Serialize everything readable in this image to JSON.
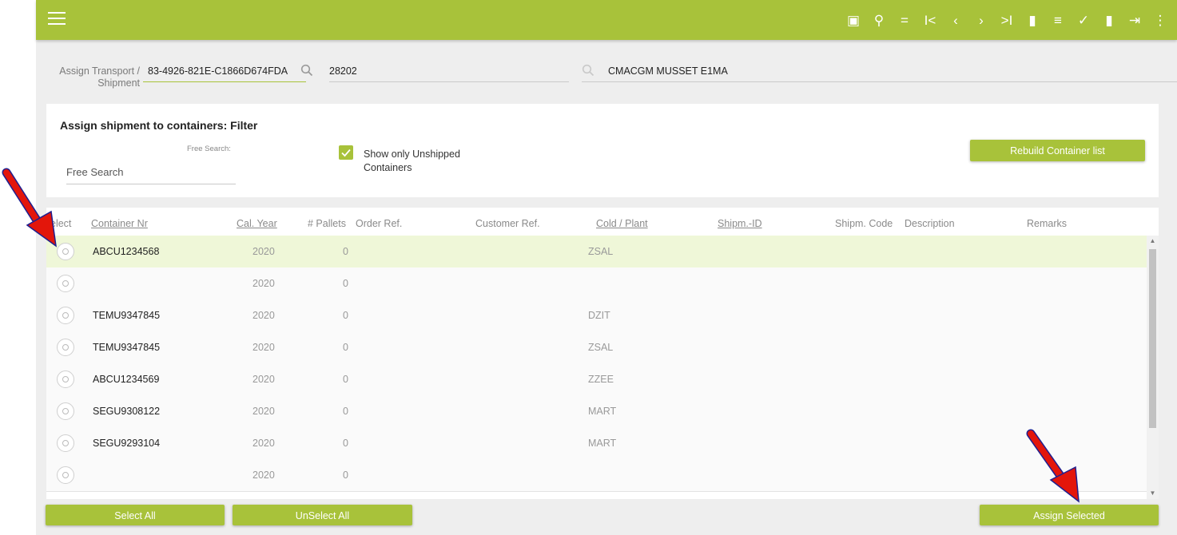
{
  "toolbar": {
    "menu_icon": "hamburger-menu-icon",
    "icons": [
      {
        "name": "calendar-icon",
        "glyph": "▣"
      },
      {
        "name": "search-icon",
        "glyph": "⚲"
      },
      {
        "name": "equals-icon",
        "glyph": "="
      },
      {
        "name": "first-record-icon",
        "glyph": "I<"
      },
      {
        "name": "previous-record-icon",
        "glyph": "‹"
      },
      {
        "name": "next-record-icon",
        "glyph": "›"
      },
      {
        "name": "last-record-icon",
        "glyph": ">I"
      },
      {
        "name": "document-icon",
        "glyph": "▮"
      },
      {
        "name": "list-icon",
        "glyph": "≡"
      },
      {
        "name": "checkmark-icon",
        "glyph": "✓"
      },
      {
        "name": "trash-icon",
        "glyph": "▮"
      },
      {
        "name": "exit-icon",
        "glyph": "⇥"
      },
      {
        "name": "more-vert-icon",
        "glyph": "⋮"
      }
    ]
  },
  "header": {
    "assign_label": "Assign Transport / Shipment",
    "transport_id": "83-4926-821E-C1866D674FDA",
    "shipment_number": "28202",
    "vessel_name": "CMACGM MUSSET E1MA"
  },
  "filter": {
    "title": "Assign shipment to containers: Filter",
    "free_search_label": "Free Search:",
    "free_search_placeholder": "Free Search",
    "show_unshipped_checked": true,
    "show_unshipped_label": "Show only Unshipped Containers",
    "rebuild_label": "Rebuild Container list"
  },
  "grid": {
    "headers": {
      "select": "elect",
      "container_nr": "Container Nr",
      "cal_year": "Cal. Year",
      "pallets": "# Pallets",
      "order_ref": "Order Ref.",
      "customer_ref": "Customer Ref.",
      "cold_plant": "Cold / Plant",
      "shipm_id": "Shipm.-ID",
      "shipm_code": "Shipm. Code",
      "description": "Description",
      "remarks": "Remarks"
    },
    "rows": [
      {
        "container": "ABCU1234568",
        "year": "2020",
        "pallets": "0",
        "plant": "ZSAL",
        "selected": true
      },
      {
        "container": "",
        "year": "2020",
        "pallets": "0",
        "plant": "",
        "selected": false
      },
      {
        "container": "TEMU9347845",
        "year": "2020",
        "pallets": "0",
        "plant": "DZIT",
        "selected": false
      },
      {
        "container": "TEMU9347845",
        "year": "2020",
        "pallets": "0",
        "plant": "ZSAL",
        "selected": false
      },
      {
        "container": "ABCU1234569",
        "year": "2020",
        "pallets": "0",
        "plant": "ZZEE",
        "selected": false
      },
      {
        "container": "SEGU9308122",
        "year": "2020",
        "pallets": "0",
        "plant": "MART",
        "selected": false
      },
      {
        "container": "SEGU9293104",
        "year": "2020",
        "pallets": "0",
        "plant": "MART",
        "selected": false
      },
      {
        "container": "",
        "year": "2020",
        "pallets": "0",
        "plant": "",
        "selected": false
      }
    ]
  },
  "buttons": {
    "select_all": "Select All",
    "unselect_all": "UnSelect All",
    "assign_selected": "Assign Selected"
  },
  "colors": {
    "accent": "#a8c23a",
    "selected_row": "#eff7d8",
    "annotation_arrow": "#e3160b"
  }
}
